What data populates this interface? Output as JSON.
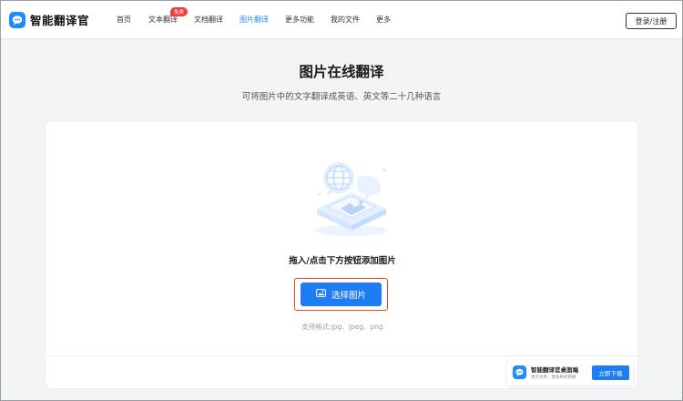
{
  "app": {
    "name": "智能翻译官"
  },
  "nav": {
    "items": [
      {
        "label": "首页"
      },
      {
        "label": "文本翻译",
        "badge": "免费"
      },
      {
        "label": "文档翻译"
      },
      {
        "label": "图片翻译",
        "active": true
      },
      {
        "label": "更多功能"
      },
      {
        "label": "我的文件"
      },
      {
        "label": "更多"
      }
    ]
  },
  "header": {
    "login_label": "登录/注册"
  },
  "hero": {
    "title": "图片在线翻译",
    "subtitle": "可将图片中的文字翻译成英语、英文等二十几种语言"
  },
  "upload": {
    "hint": "拖入/点击下方按钮添加图片",
    "button_label": "选择图片",
    "button_icon": "image-icon",
    "formats": "支持格式:jpg、jpeg、png"
  },
  "promo": {
    "title": "智能翻译官桌面端",
    "desc": "更大文件、更多格式转换",
    "button_label": "立即下载"
  },
  "colors": {
    "accent": "#1e7cf5",
    "badge": "#f23b3b",
    "highlight": "#e4462d"
  }
}
